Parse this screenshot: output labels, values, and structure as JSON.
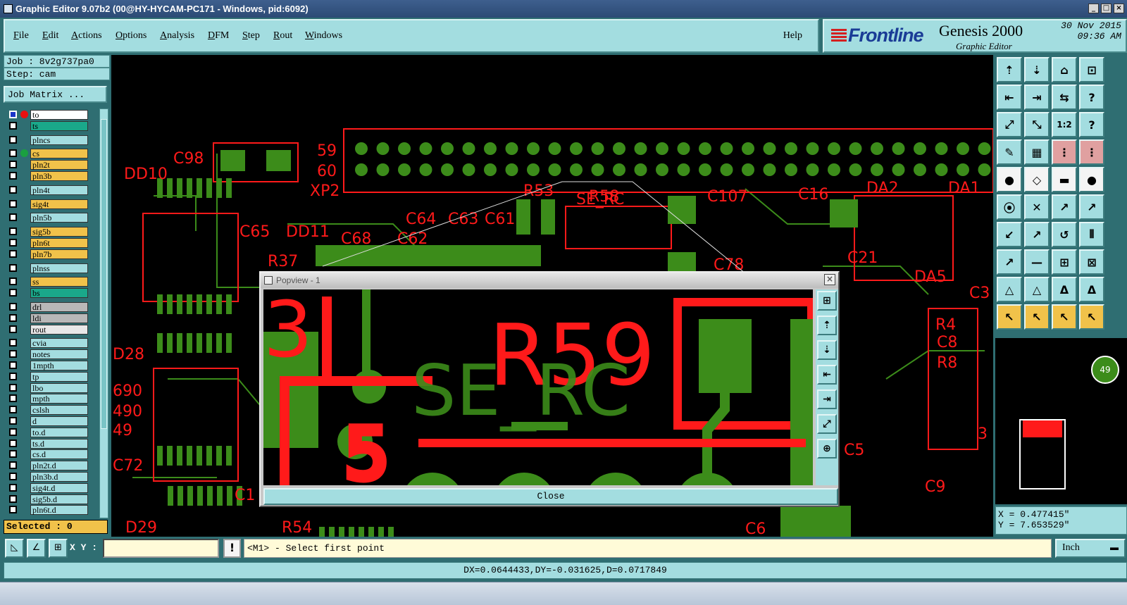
{
  "window": {
    "title": "Graphic Editor 9.07b2 (00@HY-HYCAM-PC171 - Windows, pid:6092)"
  },
  "menu": {
    "items": [
      "File",
      "Edit",
      "Actions",
      "Options",
      "Analysis",
      "DFM",
      "Step",
      "Rout",
      "Windows"
    ],
    "help": "Help"
  },
  "brand": {
    "logo": "Frontline",
    "product": "Genesis 2000",
    "subtitle": "Graphic Editor",
    "date": "30 Nov 2015",
    "time": "09:36 AM"
  },
  "job": {
    "job_line": "Job : 8v2g737pa0",
    "step_line": "Step: cam",
    "matrix_button": "Job Matrix ..."
  },
  "layers": [
    {
      "name": "to",
      "color": "#ffffff",
      "checked": true,
      "dot": "#e81010",
      "gap": false
    },
    {
      "name": "ts",
      "color": "#1aa88a",
      "checked": false,
      "dot": "",
      "gap": false
    },
    {
      "name": "plncs",
      "color": "#a3dde0",
      "checked": false,
      "dot": "",
      "gap": true
    },
    {
      "name": "cs",
      "color": "#f1c24a",
      "checked": false,
      "dot": "#1aa040",
      "gap": true
    },
    {
      "name": "pln2t",
      "color": "#f1c24a",
      "checked": false,
      "dot": "",
      "gap": false
    },
    {
      "name": "pln3b",
      "color": "#f1c24a",
      "checked": false,
      "dot": "",
      "gap": false
    },
    {
      "name": "pln4t",
      "color": "#a3dde0",
      "checked": false,
      "dot": "",
      "gap": true
    },
    {
      "name": "sig4t",
      "color": "#f1c24a",
      "checked": false,
      "dot": "",
      "gap": true
    },
    {
      "name": "pln5b",
      "color": "#a3dde0",
      "checked": false,
      "dot": "",
      "gap": true
    },
    {
      "name": "sig5b",
      "color": "#f1c24a",
      "checked": false,
      "dot": "",
      "gap": true
    },
    {
      "name": "pln6t",
      "color": "#f1c24a",
      "checked": false,
      "dot": "",
      "gap": false
    },
    {
      "name": "pln7b",
      "color": "#f1c24a",
      "checked": false,
      "dot": "",
      "gap": false
    },
    {
      "name": "plnss",
      "color": "#a3dde0",
      "checked": false,
      "dot": "",
      "gap": true
    },
    {
      "name": "ss",
      "color": "#f1c24a",
      "checked": false,
      "dot": "",
      "gap": true
    },
    {
      "name": "bs",
      "color": "#1aa88a",
      "checked": false,
      "dot": "",
      "gap": false
    },
    {
      "name": "drl",
      "color": "#b8b8b8",
      "checked": false,
      "dot": "",
      "gap": true
    },
    {
      "name": "ldi",
      "color": "#b8b8b8",
      "checked": false,
      "dot": "",
      "gap": false
    },
    {
      "name": "rout",
      "color": "#e8e8e8",
      "checked": false,
      "dot": "",
      "gap": false
    },
    {
      "name": "cvia",
      "color": "#a3dde0",
      "checked": false,
      "dot": "",
      "gap": true
    },
    {
      "name": "notes",
      "color": "#a3dde0",
      "checked": false,
      "dot": "",
      "gap": false
    },
    {
      "name": "1mpth",
      "color": "#a3dde0",
      "checked": false,
      "dot": "",
      "gap": false
    },
    {
      "name": "tp",
      "color": "#a3dde0",
      "checked": false,
      "dot": "",
      "gap": false
    },
    {
      "name": "lbo",
      "color": "#a3dde0",
      "checked": false,
      "dot": "",
      "gap": false
    },
    {
      "name": "mpth",
      "color": "#a3dde0",
      "checked": false,
      "dot": "",
      "gap": false
    },
    {
      "name": "cslsh",
      "color": "#a3dde0",
      "checked": false,
      "dot": "",
      "gap": false
    },
    {
      "name": "d",
      "color": "#a3dde0",
      "checked": false,
      "dot": "",
      "gap": false
    },
    {
      "name": "to.d",
      "color": "#a3dde0",
      "checked": false,
      "dot": "",
      "gap": false
    },
    {
      "name": "ts.d",
      "color": "#a3dde0",
      "checked": false,
      "dot": "",
      "gap": false
    },
    {
      "name": "cs.d",
      "color": "#a3dde0",
      "checked": false,
      "dot": "",
      "gap": false
    },
    {
      "name": "pln2t.d",
      "color": "#a3dde0",
      "checked": false,
      "dot": "",
      "gap": false
    },
    {
      "name": "pln3b.d",
      "color": "#a3dde0",
      "checked": false,
      "dot": "",
      "gap": false
    },
    {
      "name": "sig4t.d",
      "color": "#a3dde0",
      "checked": false,
      "dot": "",
      "gap": false
    },
    {
      "name": "sig5b.d",
      "color": "#a3dde0",
      "checked": false,
      "dot": "",
      "gap": false
    },
    {
      "name": "pln6t.d",
      "color": "#a3dde0",
      "checked": false,
      "dot": "",
      "gap": false
    }
  ],
  "selected": "Selected : 0",
  "board_labels": [
    "DD10",
    "C98",
    "59",
    "60",
    "XP2",
    "R53",
    "R58",
    "SE_RC",
    "C107",
    "C16",
    "DA2",
    "DA1",
    "C65",
    "DD11",
    "R37",
    "C68",
    "C62",
    "C64",
    "C63",
    "C61",
    "C78",
    "C21",
    "DA5",
    "C3",
    "R4",
    "C8",
    "R8",
    "C9",
    "D28",
    "690",
    "490",
    "49",
    "C72",
    "C1",
    "D29",
    "R54",
    "C6",
    "C5",
    "3"
  ],
  "popup": {
    "title": "Popview - 1",
    "labels": [
      "3",
      "R59",
      "SE_RC",
      "5"
    ],
    "close_label": "Close"
  },
  "coords": {
    "x": "X = 0.477415\"",
    "y": "Y = 7.653529\""
  },
  "minimap": {
    "badge": "49"
  },
  "bottom": {
    "xy_label": "X Y :",
    "excl": "!",
    "prompt": "<M1> - Select first point",
    "units": "Inch"
  },
  "status": "DX=0.0644433,DY=-0.031625,D=0.0717849",
  "colors": {
    "red": "#ff1a1a",
    "green": "#3c8c1a",
    "panel": "#a3dde0",
    "bg": "#2f6e72"
  }
}
